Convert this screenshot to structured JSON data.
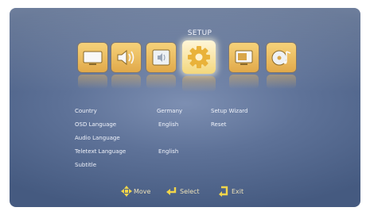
{
  "header": {
    "selected_tab_label": "SETUP"
  },
  "tabs": [
    {
      "icon": "tv-screen-icon"
    },
    {
      "icon": "speaker-icon"
    },
    {
      "icon": "volume-icon"
    },
    {
      "icon": "gear-icon",
      "selected": true
    },
    {
      "icon": "tv-settings-icon"
    },
    {
      "icon": "media-icon"
    }
  ],
  "settings": [
    {
      "label": "Country",
      "value": "Germany"
    },
    {
      "label": "OSD Language",
      "value": "English"
    },
    {
      "label": "Audio Language",
      "value": ""
    },
    {
      "label": "Teletext Language",
      "value": "English"
    },
    {
      "label": "Subtitle",
      "value": ""
    }
  ],
  "actions": [
    {
      "label": "Setup Wizard"
    },
    {
      "label": "Reset"
    }
  ],
  "footer": {
    "hints": [
      {
        "label": "Move",
        "icon": "move-arrows-icon"
      },
      {
        "label": "Select",
        "icon": "enter-arrow-icon"
      },
      {
        "label": "Exit",
        "icon": "exit-arrow-icon"
      }
    ]
  },
  "colors": {
    "accent": "#e6b14f",
    "selected_tile": "#fff2c6",
    "background": "#5e7298"
  }
}
